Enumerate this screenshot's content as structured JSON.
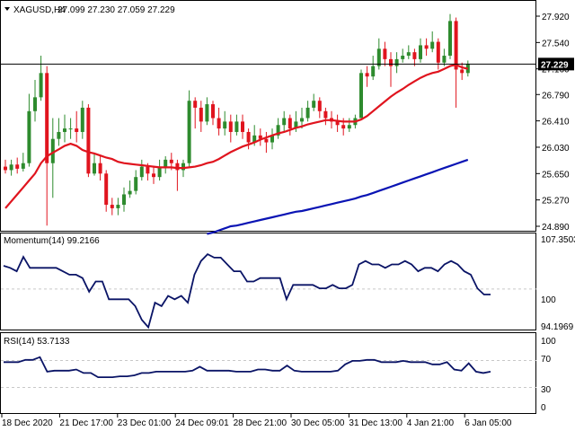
{
  "header": {
    "symbol": "XAGUSD,H4",
    "ohlc": "27.099 27.230 27.059 27.229"
  },
  "price_tag": "27.229",
  "colors": {
    "bull": "#2e8b2e",
    "bear": "#e0141e",
    "ma_fast": "#e0141e",
    "ma_slow": "#0a14b4",
    "indicator": "#0a1466",
    "price_line": "#000000",
    "grid": "#c8c8c8"
  },
  "panels": {
    "momentum": {
      "label": "Momentum(14) 99.2166",
      "ticks": [
        "107.3503",
        "100",
        "94.1969"
      ]
    },
    "rsi": {
      "label": "RSI(14) 53.7133",
      "ticks": [
        "100",
        "70",
        "30",
        "0"
      ]
    }
  },
  "time_axis": [
    "18 Dec 2020",
    "21 Dec 17:00",
    "23 Dec 01:00",
    "24 Dec 09:01",
    "28 Dec 21:00",
    "30 Dec 05:00",
    "31 Dec 13:00",
    "4 Jan 21:00",
    "6 Jan 05:00"
  ],
  "chart_data": [
    {
      "type": "candlestick",
      "price_ticks": [
        "27.920",
        "27.540",
        "27.160",
        "26.790",
        "26.410",
        "26.030",
        "25.650",
        "25.270",
        "24.890"
      ],
      "ylim": [
        24.89,
        27.92
      ],
      "last_price": 27.229,
      "candles": [
        [
          25.75,
          25.7,
          25.85,
          25.65
        ],
        [
          25.7,
          25.78,
          25.85,
          25.62
        ],
        [
          25.78,
          25.72,
          25.88,
          25.65
        ],
        [
          25.72,
          25.8,
          25.95,
          25.68
        ],
        [
          25.8,
          26.55,
          26.8,
          25.75
        ],
        [
          26.55,
          26.75,
          27.0,
          26.4
        ],
        [
          26.75,
          27.1,
          27.35,
          26.7
        ],
        [
          27.1,
          25.8,
          27.2,
          24.9
        ],
        [
          25.8,
          26.15,
          26.45,
          25.3
        ],
        [
          26.15,
          26.25,
          26.45,
          26.05
        ],
        [
          26.25,
          26.3,
          26.5,
          26.1
        ],
        [
          26.3,
          26.3,
          26.45,
          26.15
        ],
        [
          26.3,
          26.25,
          26.55,
          26.1
        ],
        [
          26.25,
          26.6,
          26.7,
          26.15
        ],
        [
          26.6,
          25.65,
          26.65,
          25.6
        ],
        [
          25.65,
          25.8,
          25.95,
          25.62
        ],
        [
          25.8,
          25.65,
          25.9,
          25.55
        ],
        [
          25.65,
          25.2,
          25.7,
          25.1
        ],
        [
          25.2,
          25.15,
          25.3,
          25.05
        ],
        [
          25.15,
          25.2,
          25.3,
          25.05
        ],
        [
          25.2,
          25.35,
          25.45,
          25.1
        ],
        [
          25.35,
          25.4,
          25.55,
          25.3
        ],
        [
          25.4,
          25.6,
          25.7,
          25.35
        ],
        [
          25.6,
          25.75,
          25.85,
          25.55
        ],
        [
          25.75,
          25.65,
          25.8,
          25.55
        ],
        [
          25.65,
          25.6,
          25.75,
          25.5
        ],
        [
          25.6,
          25.75,
          25.85,
          25.55
        ],
        [
          25.75,
          25.85,
          25.9,
          25.65
        ],
        [
          25.85,
          25.8,
          25.95,
          25.7
        ],
        [
          25.8,
          25.7,
          25.85,
          25.4
        ],
        [
          25.7,
          25.8,
          25.85,
          25.6
        ],
        [
          25.8,
          26.7,
          26.85,
          25.75
        ],
        [
          26.7,
          26.6,
          26.75,
          26.3
        ],
        [
          26.6,
          26.4,
          26.7,
          26.25
        ],
        [
          26.4,
          26.65,
          26.75,
          26.35
        ],
        [
          26.65,
          26.45,
          26.7,
          26.35
        ],
        [
          26.45,
          26.3,
          26.6,
          26.2
        ],
        [
          26.3,
          26.4,
          26.55,
          26.2
        ],
        [
          26.4,
          26.25,
          26.5,
          26.1
        ],
        [
          26.25,
          26.4,
          26.5,
          26.2
        ],
        [
          26.4,
          26.25,
          26.5,
          26.15
        ],
        [
          26.25,
          26.1,
          26.3,
          26.0
        ],
        [
          26.1,
          26.2,
          26.35,
          26.05
        ],
        [
          26.2,
          26.15,
          26.3,
          26.05
        ],
        [
          26.15,
          26.1,
          26.25,
          25.95
        ],
        [
          26.1,
          26.2,
          26.3,
          26.0
        ],
        [
          26.2,
          26.35,
          26.45,
          26.15
        ],
        [
          26.35,
          26.45,
          26.55,
          26.25
        ],
        [
          26.45,
          26.3,
          26.5,
          26.2
        ],
        [
          26.3,
          26.4,
          26.55,
          26.25
        ],
        [
          26.4,
          26.45,
          26.6,
          26.3
        ],
        [
          26.45,
          26.6,
          26.7,
          26.4
        ],
        [
          26.6,
          26.7,
          26.8,
          26.55
        ],
        [
          26.7,
          26.55,
          26.75,
          26.45
        ],
        [
          26.55,
          26.45,
          26.6,
          26.35
        ],
        [
          26.45,
          26.4,
          26.55,
          26.3
        ],
        [
          26.4,
          26.35,
          26.5,
          26.25
        ],
        [
          26.35,
          26.3,
          26.45,
          26.2
        ],
        [
          26.3,
          26.35,
          26.45,
          26.25
        ],
        [
          26.35,
          26.45,
          26.5,
          26.3
        ],
        [
          26.45,
          27.1,
          27.15,
          26.65
        ],
        [
          27.1,
          27.05,
          27.2,
          26.9
        ],
        [
          27.05,
          27.2,
          27.35,
          27.0
        ],
        [
          27.2,
          27.45,
          27.6,
          27.15
        ],
        [
          27.45,
          27.3,
          27.55,
          27.2
        ],
        [
          27.3,
          27.2,
          27.4,
          26.9
        ],
        [
          27.2,
          27.3,
          27.4,
          27.1
        ],
        [
          27.3,
          27.35,
          27.45,
          27.25
        ],
        [
          27.35,
          27.4,
          27.5,
          27.3
        ],
        [
          27.4,
          27.3,
          27.45,
          27.2
        ],
        [
          27.3,
          27.5,
          27.6,
          27.25
        ],
        [
          27.5,
          27.45,
          27.6,
          27.35
        ],
        [
          27.45,
          27.55,
          27.7,
          27.4
        ],
        [
          27.55,
          27.25,
          27.6,
          27.15
        ],
        [
          27.25,
          27.35,
          27.45,
          27.2
        ],
        [
          27.35,
          27.85,
          27.95,
          27.3
        ],
        [
          27.85,
          27.15,
          27.9,
          26.6
        ],
        [
          27.15,
          27.1,
          27.25,
          27.0
        ],
        [
          27.1,
          27.23,
          27.28,
          27.05
        ]
      ],
      "ma_fast": [
        25.15,
        25.25,
        25.35,
        25.45,
        25.55,
        25.65,
        25.8,
        25.9,
        25.95,
        26.0,
        26.05,
        26.08,
        26.05,
        25.99,
        25.96,
        25.94,
        25.91,
        25.88,
        25.86,
        25.82,
        25.8,
        25.79,
        25.78,
        25.77,
        25.76,
        25.75,
        25.74,
        25.74,
        25.74,
        25.73,
        25.73,
        25.74,
        25.75,
        25.77,
        25.8,
        25.82,
        25.86,
        25.91,
        25.96,
        26.0,
        26.04,
        26.07,
        26.1,
        26.14,
        26.17,
        26.2,
        26.23,
        26.25,
        26.28,
        26.31,
        26.33,
        26.36,
        26.38,
        26.4,
        26.42,
        26.42,
        26.41,
        26.4,
        26.4,
        26.4,
        26.43,
        26.48,
        26.55,
        26.62,
        26.69,
        26.76,
        26.82,
        26.87,
        26.93,
        26.98,
        27.03,
        27.07,
        27.1,
        27.12,
        27.16,
        27.2,
        27.22,
        27.18,
        27.16
      ],
      "ma_slow": [
        24.78,
        24.8,
        24.83,
        24.86,
        24.89,
        24.9,
        24.92,
        24.94,
        24.96,
        24.98,
        25.0,
        25.02,
        25.04,
        25.06,
        25.08,
        25.1,
        25.11,
        25.13,
        25.15,
        25.17,
        25.19,
        25.21,
        25.23,
        25.25,
        25.27,
        25.29,
        25.32,
        25.34,
        25.37,
        25.4,
        25.43,
        25.46,
        25.49,
        25.52,
        25.55,
        25.58,
        25.61,
        25.64,
        25.67,
        25.7,
        25.73,
        25.76,
        25.79,
        25.82,
        25.85
      ],
      "ma_slow_start_index": 34
    },
    {
      "type": "line",
      "title": "Momentum(14)",
      "ylim": [
        94.1969,
        107.3503
      ],
      "values": [
        103.4,
        103.1,
        102.6,
        104.7,
        103.1,
        103.1,
        103.1,
        103.1,
        103.1,
        102.6,
        102.1,
        102.1,
        101.6,
        99.6,
        101.1,
        101.1,
        98.5,
        98.5,
        98.5,
        98.5,
        97.5,
        95.5,
        94.4,
        98.0,
        97.5,
        99.0,
        98.5,
        99.0,
        98.0,
        102.1,
        104.1,
        105.1,
        104.6,
        104.6,
        103.6,
        102.6,
        102.6,
        101.1,
        101.1,
        101.6,
        101.6,
        101.6,
        101.6,
        98.5,
        100.6,
        100.6,
        100.6,
        100.6,
        100.1,
        100.1,
        100.6,
        100.1,
        100.1,
        100.6,
        103.6,
        104.1,
        103.6,
        103.6,
        103.1,
        103.6,
        103.6,
        104.1,
        103.6,
        102.6,
        103.1,
        103.1,
        102.6,
        103.6,
        104.1,
        103.6,
        102.6,
        102.1,
        100.1,
        99.2,
        99.2
      ]
    },
    {
      "type": "line",
      "title": "RSI(14)",
      "ylim": [
        0,
        100
      ],
      "values": [
        67.6,
        67.6,
        67.6,
        71.0,
        71.0,
        75.1,
        53.4,
        55.0,
        55.0,
        55.0,
        56.7,
        51.5,
        51.5,
        45.2,
        45.2,
        45.2,
        46.5,
        46.5,
        48.0,
        51.5,
        51.5,
        53.4,
        53.4,
        53.4,
        53.4,
        53.4,
        55.0,
        60.8,
        55.0,
        55.0,
        55.0,
        55.0,
        53.4,
        53.4,
        53.4,
        56.7,
        56.7,
        55.0,
        55.0,
        62.6,
        55.0,
        53.4,
        53.4,
        53.4,
        53.4,
        53.4,
        55.0,
        64.3,
        69.4,
        69.4,
        71.0,
        71.0,
        67.6,
        67.6,
        67.6,
        69.4,
        67.6,
        67.6,
        67.6,
        64.3,
        64.3,
        67.6,
        56.7,
        55.0,
        65.9,
        53.4,
        51.5,
        53.4
      ]
    }
  ]
}
